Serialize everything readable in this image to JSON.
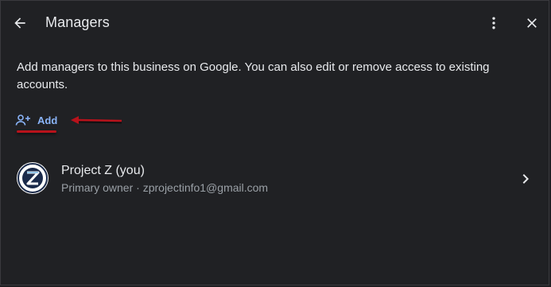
{
  "header": {
    "title": "Managers",
    "back_icon": "arrow-back-icon",
    "more_icon": "more-vert-icon",
    "close_icon": "close-icon"
  },
  "main": {
    "description": "Add managers to this business on Google. You can also edit or remove access to existing accounts.",
    "add_label": "Add",
    "add_icon": "person-add-icon",
    "accent_color": "#8ab4f8",
    "annotation_color": "#b8121b"
  },
  "managers": [
    {
      "name": "Project Z (you)",
      "role": "Primary owner",
      "separator": " · ",
      "email": "zprojectinfo1@gmail.com",
      "avatar_icon": "project-z-logo-icon",
      "chevron_icon": "chevron-right-icon"
    }
  ]
}
